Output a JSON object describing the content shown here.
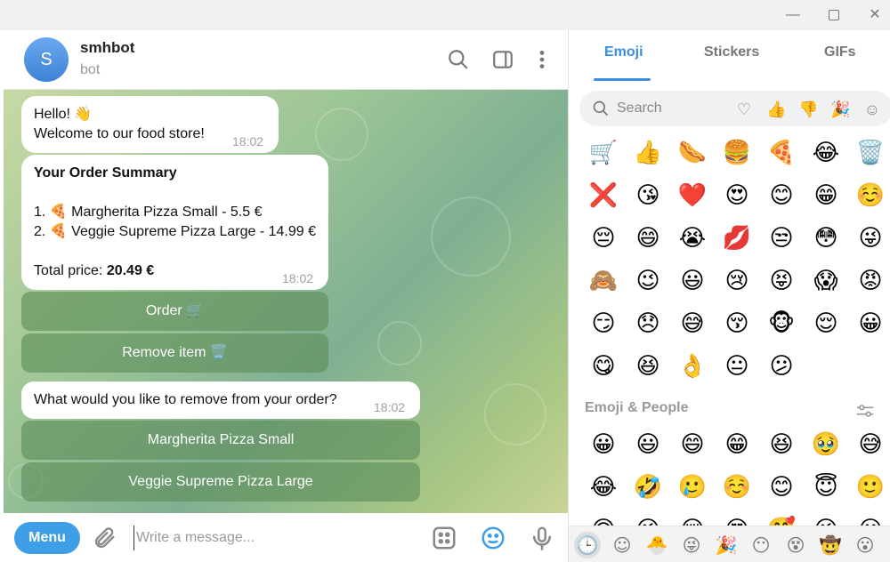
{
  "window": {
    "min_glyph": "—",
    "close_glyph": "✕"
  },
  "chat": {
    "avatar_letter": "S",
    "name": "smhbot",
    "status": "bot",
    "messages": {
      "greeting": {
        "line1": "Hello! 👋",
        "line2": "Welcome to our food store!",
        "time": "18:02"
      },
      "summary": {
        "title": "Your Order Summary",
        "item1": "1. 🍕 Margherita Pizza Small - 5.5 €",
        "item2": "2. 🍕 Veggie Supreme Pizza Large - 14.99 €",
        "total_label": "Total price: ",
        "total_value": "20.49 €",
        "time": "18:02"
      },
      "remove_prompt": {
        "text": "What would you like to remove from your order?",
        "time": "18:02"
      }
    },
    "buttons": {
      "order": "Order 🛒",
      "remove_item": "Remove item 🗑️",
      "remove_margherita": "Margherita Pizza Small",
      "remove_veggie": "Veggie Supreme Pizza Large"
    },
    "composer": {
      "menu_label": "Menu",
      "placeholder": "Write a message..."
    }
  },
  "emoji_panel": {
    "tabs": [
      "Emoji",
      "Stickers",
      "GIFs"
    ],
    "active_tab": "Emoji",
    "search_placeholder": "Search",
    "filters": [
      "♡",
      "👍",
      "👎",
      "🎉",
      "☺"
    ],
    "recent_emojis": [
      "🛒",
      "👍",
      "🌭",
      "🍔",
      "🍕",
      "😂",
      "🗑️",
      "❌",
      "😘",
      "❤️",
      "😍",
      "😊",
      "😁",
      "☺️",
      "😔",
      "😄",
      "😭",
      "💋",
      "😒",
      "😳",
      "😜",
      "🙈",
      "😉",
      "😃",
      "😢",
      "😝",
      "😱",
      "😡",
      "😏",
      "😞",
      "😅",
      "😚",
      "🐵",
      "😌",
      "😀",
      "😋",
      "😆",
      "👌",
      "😐",
      "😕"
    ],
    "section_title": "Emoji & People",
    "people_emojis": [
      "😀",
      "😃",
      "😄",
      "😁",
      "😆",
      "🥹",
      "😅",
      "😂",
      "🤣",
      "🥲",
      "☺️",
      "😊",
      "😇",
      "🙂",
      "🙃",
      "😉",
      "😌",
      "😍",
      "🥰",
      "😘",
      "😗"
    ],
    "categories": [
      "🕒",
      "☺",
      "🐣",
      "😜",
      "🎉",
      "😶",
      "😵",
      "🤠",
      "😮"
    ]
  }
}
